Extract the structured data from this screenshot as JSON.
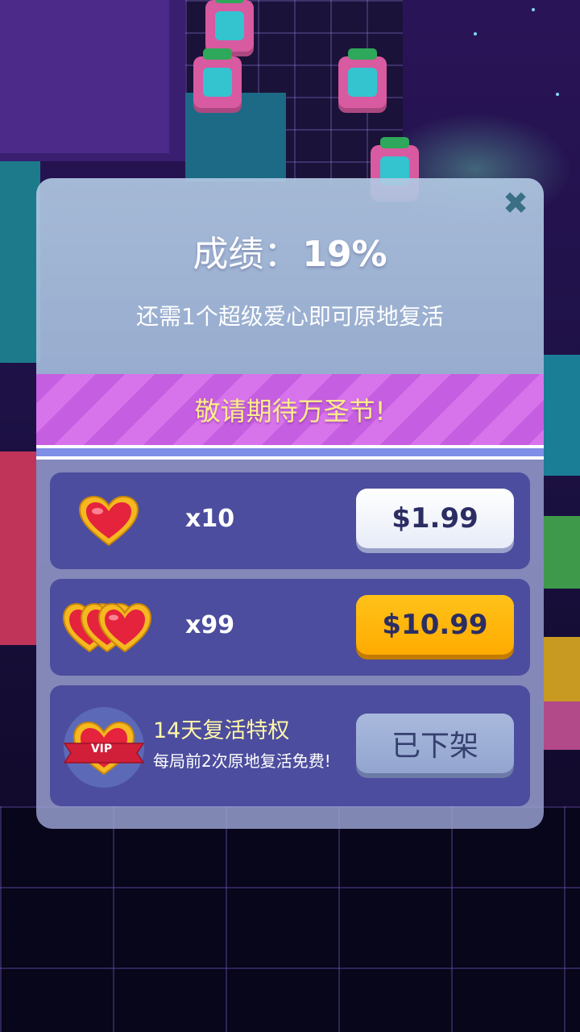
{
  "popup": {
    "close_icon": "close-icon",
    "score_label": "成绩：",
    "score_value": "19%",
    "revive_message": "还需1个超级爱心即可原地复活",
    "banner_text": "敬请期待万圣节!"
  },
  "offers": [
    {
      "icon": "single-gold-heart-icon",
      "quantity": "x10",
      "price": "$1.99"
    },
    {
      "icon": "triple-gold-heart-icon",
      "quantity": "x99",
      "price": "$10.99"
    }
  ],
  "vip_offer": {
    "icon": "vip-heart-badge-icon",
    "badge_text": "VIP",
    "title": "14天复活特权",
    "description": "每局前2次原地复活免费!",
    "button_label": "已下架"
  },
  "colors": {
    "banner_text": "#ffec8a",
    "price_gold": "#ffb400",
    "row_bg": "#4c4d9e",
    "close_icon": "#3a6f86"
  }
}
